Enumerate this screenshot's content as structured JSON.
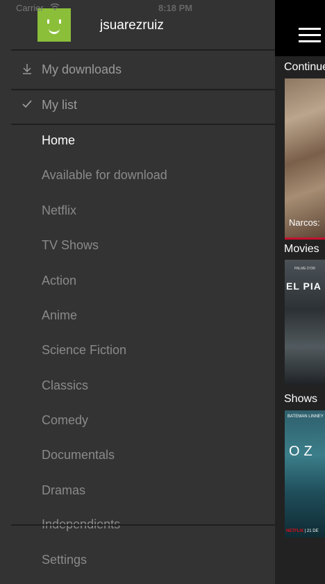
{
  "status_bar": {
    "carrier": "Carrier",
    "time": "8:18 PM"
  },
  "profile": {
    "username": "jsuarezruiz"
  },
  "menu": {
    "top_items": [
      {
        "label": "My downloads",
        "icon": "download-icon"
      },
      {
        "label": "My list",
        "icon": "check-icon"
      }
    ],
    "categories": [
      {
        "label": "Home",
        "active": true
      },
      {
        "label": "Available for download"
      },
      {
        "label": "Netflix"
      },
      {
        "label": "TV Shows"
      },
      {
        "label": "Action"
      },
      {
        "label": "Anime"
      },
      {
        "label": "Science Fiction"
      },
      {
        "label": "Classics"
      },
      {
        "label": "Comedy"
      },
      {
        "label": "Documentals"
      },
      {
        "label": "Dramas"
      },
      {
        "label": "Independients"
      }
    ],
    "settings": "Settings"
  },
  "content": {
    "sections": {
      "continue": "Continue",
      "movies": "Movies",
      "shows": "Shows"
    },
    "continue_caption": "Narcos: ",
    "movie_poster_text": "EL PIA",
    "movie_poster_small": "PALME D'OR",
    "show_poster_text": "OZ",
    "show_poster_names": "BATEMAN   LINNEY",
    "show_poster_bottom_brand": "NETFLIX",
    "show_poster_bottom_date": " | 21 DE"
  },
  "colors": {
    "accent": "#c8102e",
    "avatar": "#8bbf3a",
    "drawer_bg": "#333333"
  }
}
